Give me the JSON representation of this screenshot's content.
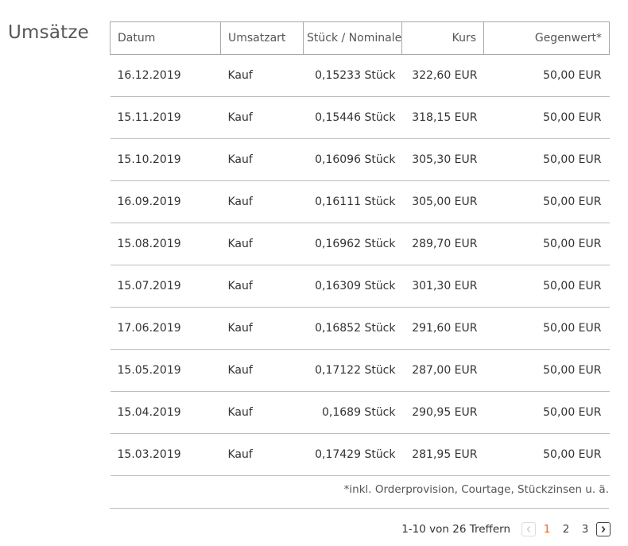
{
  "section_title": "Umsätze",
  "table": {
    "headers": [
      "Datum",
      "Umsatzart",
      "Stück / Nominale",
      "Kurs",
      "Gegenwert*"
    ],
    "rows": [
      [
        "16.12.2019",
        "Kauf",
        "0,15233 Stück",
        "322,60 EUR",
        "50,00 EUR"
      ],
      [
        "15.11.2019",
        "Kauf",
        "0,15446 Stück",
        "318,15 EUR",
        "50,00 EUR"
      ],
      [
        "15.10.2019",
        "Kauf",
        "0,16096 Stück",
        "305,30 EUR",
        "50,00 EUR"
      ],
      [
        "16.09.2019",
        "Kauf",
        "0,16111 Stück",
        "305,00 EUR",
        "50,00 EUR"
      ],
      [
        "15.08.2019",
        "Kauf",
        "0,16962 Stück",
        "289,70 EUR",
        "50,00 EUR"
      ],
      [
        "15.07.2019",
        "Kauf",
        "0,16309 Stück",
        "301,30 EUR",
        "50,00 EUR"
      ],
      [
        "17.06.2019",
        "Kauf",
        "0,16852 Stück",
        "291,60 EUR",
        "50,00 EUR"
      ],
      [
        "15.05.2019",
        "Kauf",
        "0,17122 Stück",
        "287,00 EUR",
        "50,00 EUR"
      ],
      [
        "15.04.2019",
        "Kauf",
        "0,1689 Stück",
        "290,95 EUR",
        "50,00 EUR"
      ],
      [
        "15.03.2019",
        "Kauf",
        "0,17429 Stück",
        "281,95 EUR",
        "50,00 EUR"
      ]
    ],
    "footnote": "*inkl. Orderprovision, Courtage, Stückzinsen u. ä."
  },
  "pagination": {
    "hits_label": "1-10 von 26 Treffern",
    "pages": [
      "1",
      "2",
      "3"
    ],
    "current_page": "1",
    "prev_icon": "chevron-left-icon",
    "next_icon": "chevron-right-icon"
  },
  "colors": {
    "accent": "#ff6200",
    "border": "#a8a8a8",
    "text": "#333333"
  }
}
